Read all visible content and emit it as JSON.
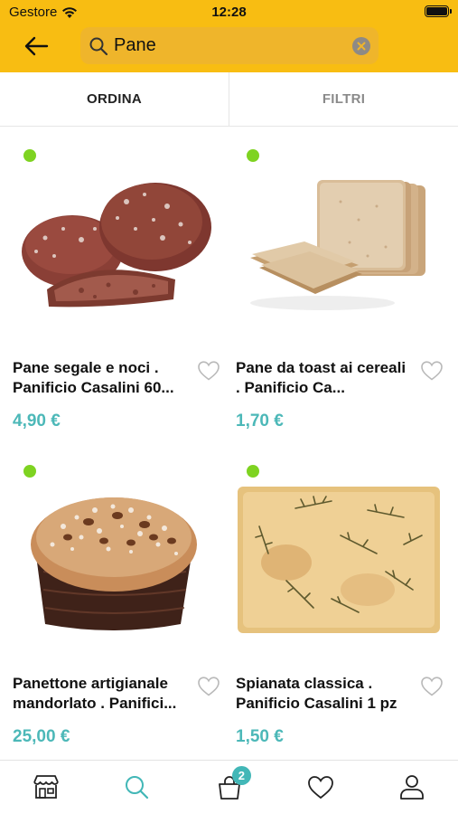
{
  "status_bar": {
    "carrier": "Gestore",
    "time": "12:28"
  },
  "search": {
    "value": "Pane",
    "placeholder": ""
  },
  "tabs": {
    "sort_label": "ORDINA",
    "filter_label": "FILTRI"
  },
  "products": [
    {
      "title": "Pane segale e noci . Panificio Casalini 60...",
      "price": "4,90 €",
      "available": true,
      "image": "rye-walnut-bread"
    },
    {
      "title": "Pane da toast ai cereali . Panificio Ca...",
      "price": "1,70 €",
      "available": true,
      "image": "sliced-toast-bread"
    },
    {
      "title": "Panettone artigianale mandorlato . Panifici...",
      "price": "25,00 €",
      "available": true,
      "image": "almond-panettone"
    },
    {
      "title": "Spianata classica . Panificio Casalini 1 pz",
      "price": "1,50 €",
      "available": true,
      "image": "rosemary-spianata"
    }
  ],
  "bottom_nav": {
    "items": [
      "store-icon",
      "search-icon",
      "cart-icon",
      "heart-icon",
      "user-icon"
    ],
    "cart_count": "2",
    "active": "search-icon"
  },
  "colors": {
    "header": "#f8bd12",
    "search_field": "#efb52b",
    "price": "#4cb8b8",
    "available_dot": "#7ed321",
    "badge": "#42b7b7",
    "active_nav": "#42b7b7"
  }
}
